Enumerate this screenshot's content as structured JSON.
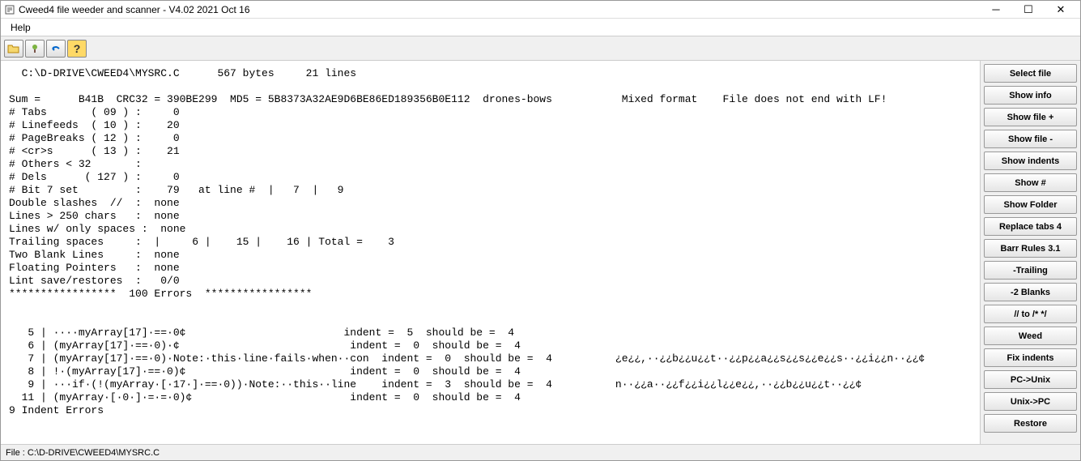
{
  "window": {
    "title": "Cweed4 file weeder and scanner - V4.02 2021 Oct 16"
  },
  "menu": {
    "help": "Help"
  },
  "content": {
    "header": "  C:\\D-DRIVE\\CWEED4\\MYSRC.C      567 bytes     21 lines",
    "sumline": "Sum =      B41B  CRC32 = 390BE299  MD5 = 5B8373A32AE9D6BE86ED189356B0E112  drones-bows           Mixed format    File does not end with LF!",
    "stats": [
      "# Tabs       ( 09 ) :     0",
      "# Linefeeds  ( 10 ) :    20",
      "# PageBreaks ( 12 ) :     0",
      "# <cr>s      ( 13 ) :    21",
      "# Others < 32       :",
      "# Dels      ( 127 ) :     0",
      "# Bit 7 set         :    79   at line #  |   7  |   9",
      "Double slashes  //  :  none",
      "Lines > 250 chars   :  none",
      "Lines w/ only spaces :  none",
      "Trailing spaces     :  |     6 |    15 |    16 | Total =    3",
      "Two Blank Lines     :  none",
      "Floating Pointers   :  none",
      "Lint save/restores  :   0/0",
      "*****************  100 Errors  *****************"
    ],
    "indentrows": [
      "   5 | ····myArray[17]·==·0¢                         indent =  5  should be =  4",
      "   6 | (myArray[17]·==·0)·¢                           indent =  0  should be =  4",
      "   7 | (myArray[17]·==·0)·Note:·this·line·fails·when··con  indent =  0  should be =  4          ¿e¿¿,··¿¿b¿¿u¿¿t··¿¿p¿¿a¿¿s¿¿s¿¿e¿¿s··¿¿i¿¿n··¿¿¢",
      "   8 | !·(myArray[17]·==·0)¢                          indent =  0  should be =  4",
      "   9 | ···if·(!(myArray·[·17·]·==·0))·Note:··this··line    indent =  3  should be =  4          n··¿¿a··¿¿f¿¿i¿¿l¿¿e¿¿,··¿¿b¿¿u¿¿t··¿¿¢",
      "  11 | (myArray·[·0·]·=·=·0)¢                         indent =  0  should be =  4"
    ],
    "indenterrors": "9 Indent Errors"
  },
  "buttons": {
    "select_file": "Select file",
    "show_info": "Show info",
    "show_file_plus": "Show file +",
    "show_file_minus": "Show file -",
    "show_indents": "Show indents",
    "show_hash": "Show #",
    "show_folder": "Show Folder",
    "replace_tabs": "Replace tabs 4",
    "barr_rules": "Barr Rules 3.1",
    "trailing": "-Trailing",
    "two_blanks": "-2 Blanks",
    "slash_to_comment": "// to /* */",
    "weed": "Weed",
    "fix_indents": "Fix indents",
    "pc_unix": "PC->Unix",
    "unix_pc": "Unix->PC",
    "restore": "Restore"
  },
  "statusbar": {
    "text": "File : C:\\D-DRIVE\\CWEED4\\MYSRC.C"
  }
}
